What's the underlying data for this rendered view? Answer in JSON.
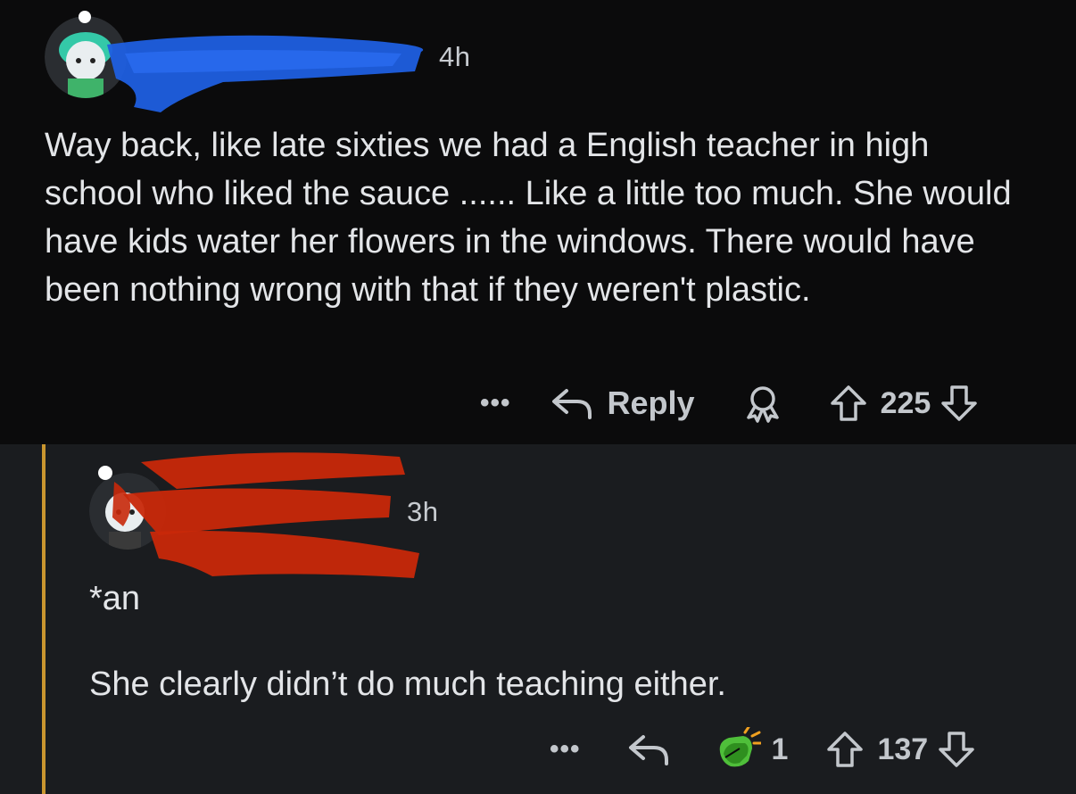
{
  "comments": [
    {
      "timestamp": "4h",
      "body": "Way back, like late sixties we had a English teacher in high school who liked the sauce ...... Like a little too much. She would have kids water her flowers in the windows. There would have been nothing wrong with that if they weren't plastic.",
      "actions": {
        "more": "•••",
        "reply_label": "Reply",
        "score": "225"
      },
      "redaction_color": "#1f5fe0",
      "avatar_color": "#34c9a8"
    },
    {
      "timestamp": "3h",
      "body_lines": [
        "*an",
        "She clearly didn’t do much teaching either."
      ],
      "actions": {
        "more": "•••",
        "award_count": "1",
        "score": "137"
      },
      "redaction_color": "#c8280a",
      "accent_line_color": "#c9962f"
    }
  ],
  "icons": {
    "reply": "reply-arrow-icon",
    "award": "award-ribbon-icon",
    "upvote": "upvote-arrow-icon",
    "downvote": "downvote-arrow-icon",
    "clapping": "clapping-hands-award-icon"
  }
}
